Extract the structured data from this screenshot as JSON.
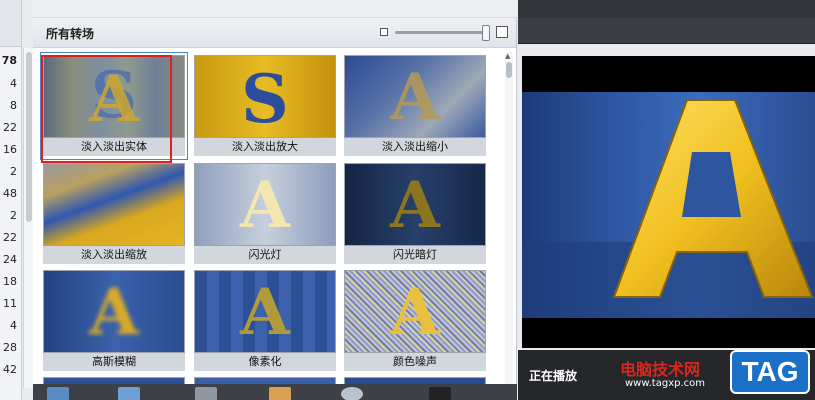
{
  "counts": [
    "78",
    "4",
    "8",
    "22",
    "16",
    "2",
    "48",
    "2",
    "22",
    "24",
    "18",
    "11",
    "4",
    "28",
    "42"
  ],
  "panel": {
    "title": "所有转场"
  },
  "tiles": [
    {
      "label": "淡入淡出实体",
      "letter": "A"
    },
    {
      "label": "淡入淡出放大",
      "letter": "S"
    },
    {
      "label": "淡入淡出缩小",
      "letter": "A"
    },
    {
      "label": "淡入淡出缩放",
      "letter": ""
    },
    {
      "label": "闪光灯",
      "letter": "A"
    },
    {
      "label": "闪光暗灯",
      "letter": "A"
    },
    {
      "label": "高斯模糊",
      "letter": "A"
    },
    {
      "label": "像素化",
      "letter": "A"
    },
    {
      "label": "颜色噪声",
      "letter": "A"
    }
  ],
  "preview": {
    "letter": "A",
    "status": "正在播放"
  },
  "watermark": {
    "title": "电脑技术网",
    "url": "www.tagxp.com",
    "logo": "TAG"
  },
  "colors": {
    "accent": "#4a86c8",
    "highlight": "#e02020",
    "gold": "#f0c020"
  }
}
